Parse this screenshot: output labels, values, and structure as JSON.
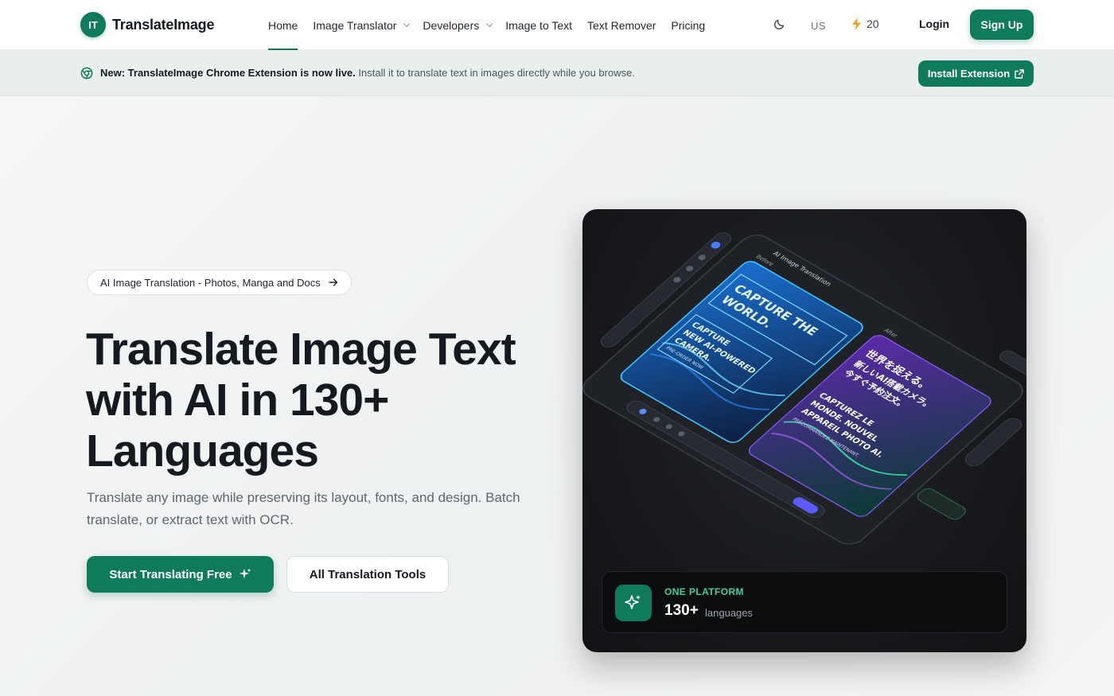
{
  "brand": {
    "badge": "IT",
    "name": "TranslateImage",
    "accent": "#0f7a5c"
  },
  "nav": {
    "items": [
      {
        "label": "Home",
        "active": true,
        "dropdown": false
      },
      {
        "label": "Image Translator",
        "active": false,
        "dropdown": true
      },
      {
        "label": "Developers",
        "active": false,
        "dropdown": true
      },
      {
        "label": "Image to Text",
        "active": false,
        "dropdown": false
      },
      {
        "label": "Text Remover",
        "active": false,
        "dropdown": false
      },
      {
        "label": "Pricing",
        "active": false,
        "dropdown": false
      }
    ],
    "theme_icon": "moon-icon",
    "locale": "US",
    "credits": "20",
    "credits_icon": "bolt-icon",
    "login": "Login",
    "signup": "Sign Up"
  },
  "announcement": {
    "icon": "chrome-icon",
    "strong": "New: TranslateImage Chrome Extension is now live.",
    "text": "Install it to translate text in images directly while you browse.",
    "button": "Install Extension"
  },
  "hero": {
    "pill": "AI Image Translation - Photos, Manga and Docs",
    "title_lines": [
      "Translate Image Text",
      "with AI in 130+",
      "Languages"
    ],
    "subtitle": "Translate any image while preserving its layout, fonts, and design. Batch translate, or extract text with OCR.",
    "cta_primary": "Start Translating Free",
    "cta_secondary": "All Translation Tools"
  },
  "showcase": {
    "panel_title": "AI Image Translation",
    "before_label": "Before",
    "after_label": "After",
    "before_text": [
      "CAPTURE THE",
      "WORLD.",
      "CAPTURE",
      "NEW AI-POWERED",
      "CAMERA.",
      "PRE-ORDER NOW"
    ],
    "after_text": [
      "世界を捉える。",
      "新しいAI搭載カメラ。",
      "今すぐ予約注文。",
      "CAPTUREZ LE",
      "MONDE. NOUVEL",
      "APPAREIL PHOTO AI.",
      "PRÉCOMMANDEZ MAINTENANT."
    ],
    "stat_label": "ONE PLATFORM",
    "stat_value": "130+",
    "stat_unit": "languages"
  }
}
